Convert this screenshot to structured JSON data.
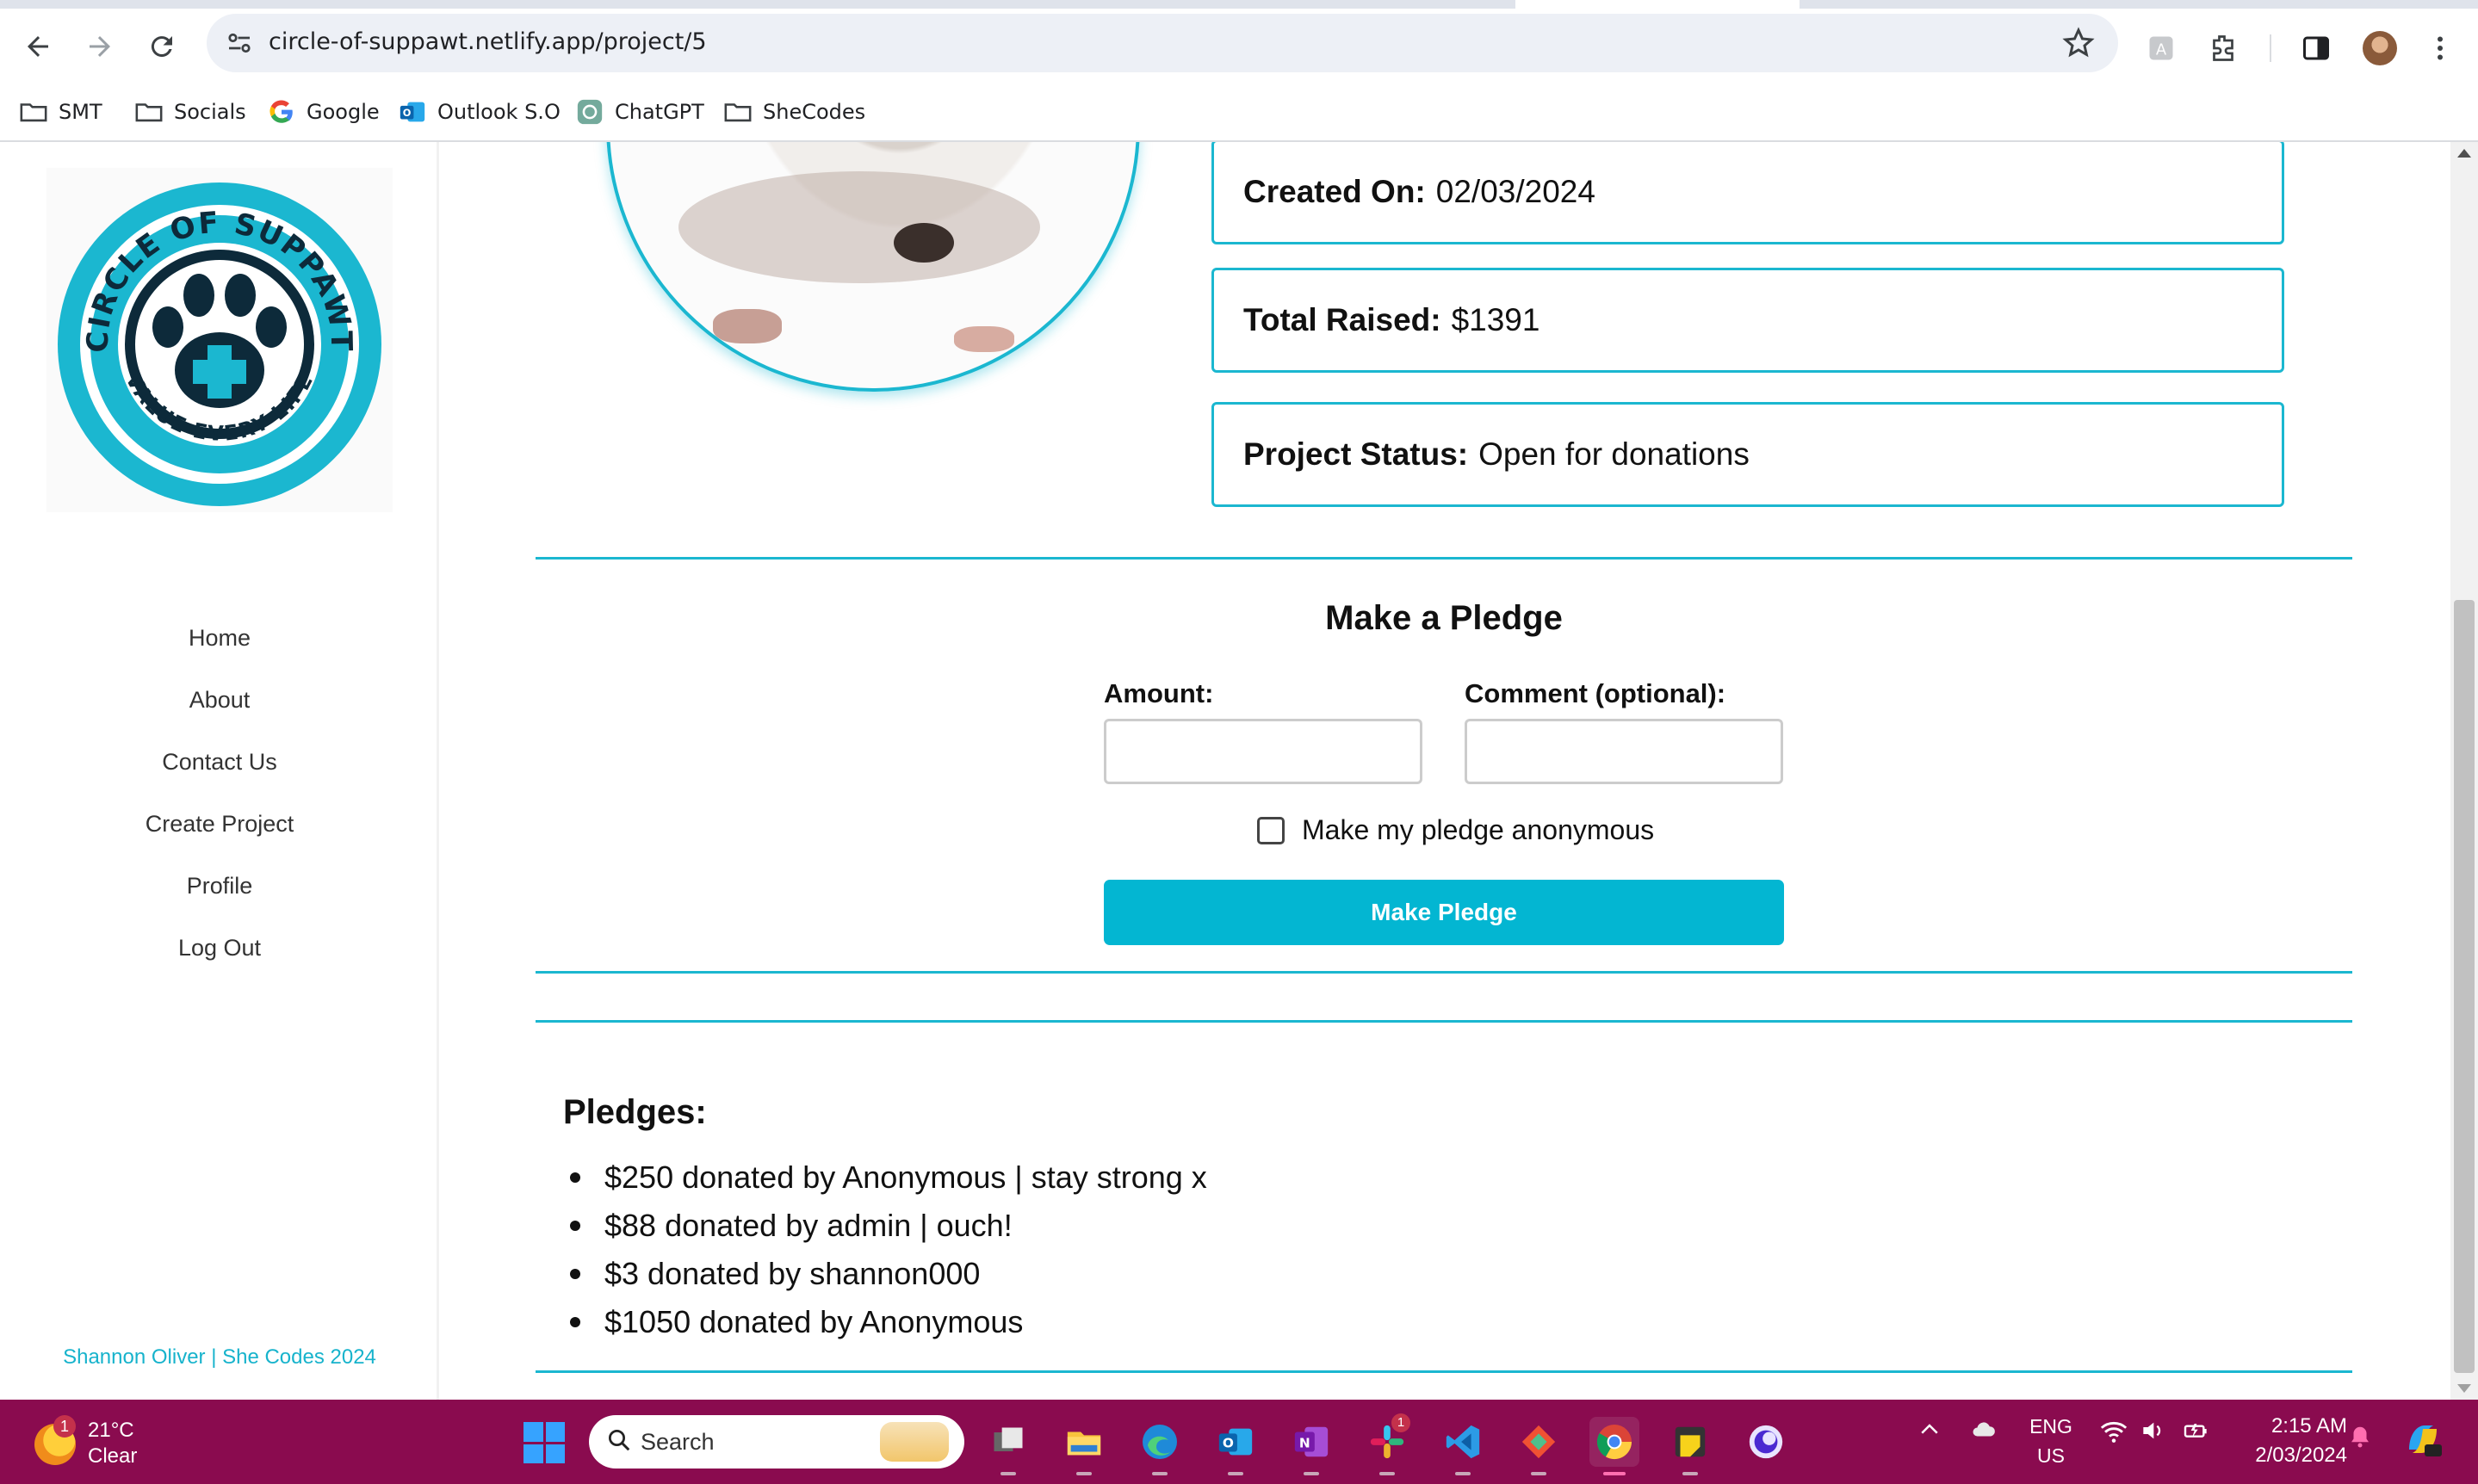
{
  "browser": {
    "url": "circle-of-suppawt.netlify.app/project/5",
    "bookmarks": [
      {
        "label": "SMT",
        "icon": "folder-icon"
      },
      {
        "label": "Socials",
        "icon": "folder-icon"
      },
      {
        "label": "Google",
        "icon": "google-icon"
      },
      {
        "label": "Outlook S.O",
        "icon": "outlook-icon"
      },
      {
        "label": "ChatGPT",
        "icon": "chatgpt-icon"
      },
      {
        "label": "SheCodes",
        "icon": "folder-icon"
      }
    ]
  },
  "sidebar": {
    "logo": {
      "top_text": "CIRCLE OF SUPPAWT",
      "bottom_text": "VALUE EVERY LIFE",
      "colors": {
        "ring": "#1bb7d0",
        "dark": "#0d2a3a"
      }
    },
    "nav": [
      {
        "label": "Home"
      },
      {
        "label": "About"
      },
      {
        "label": "Contact Us"
      },
      {
        "label": "Create Project"
      },
      {
        "label": "Profile"
      },
      {
        "label": "Log Out"
      }
    ],
    "footer": "Shannon Oliver | She Codes 2024"
  },
  "project": {
    "created_label": "Created On:",
    "created_value": "02/03/2024",
    "raised_label": "Total Raised:",
    "raised_value": "$1391",
    "status_label": "Project Status:",
    "status_value": "Open for donations"
  },
  "pledge_form": {
    "title": "Make a Pledge",
    "amount_label": "Amount:",
    "amount_value": "",
    "comment_label": "Comment (optional):",
    "comment_value": "",
    "anonymous_label": "Make my pledge anonymous",
    "anonymous_checked": false,
    "submit_label": "Make Pledge"
  },
  "pledges": {
    "heading": "Pledges:",
    "items": [
      "$250 donated by Anonymous | stay strong x",
      "$88 donated by admin | ouch!",
      "$3 donated by shannon000",
      "$1050 donated by Anonymous"
    ]
  },
  "taskbar": {
    "weather_badge": "1",
    "temperature": "21°C",
    "condition": "Clear",
    "search_placeholder": "Search",
    "slack_badge": "1",
    "lang_line1": "ENG",
    "lang_line2": "US",
    "time": "2:15 AM",
    "date": "2/03/2024"
  },
  "colors": {
    "accent": "#1bb7d0",
    "button": "#03b6d2",
    "taskbar": "#8a0b4f"
  }
}
